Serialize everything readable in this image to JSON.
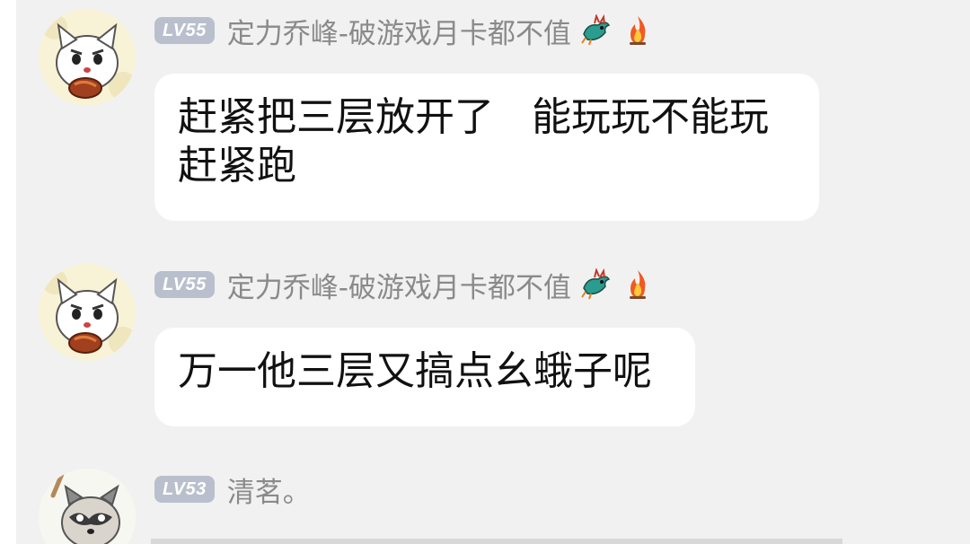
{
  "messages": [
    {
      "level": "LV55",
      "nickname": "定力乔峰-破游戏月卡都不值",
      "avatar": "white-cat-eating-meat",
      "badges": [
        "dragon-icon",
        "fire-icon"
      ],
      "text": "赶紧把三层放开了   能玩玩不能玩\n赶紧跑"
    },
    {
      "level": "LV55",
      "nickname": "定力乔峰-破游戏月卡都不值",
      "avatar": "white-cat-eating-meat",
      "badges": [
        "dragon-icon",
        "fire-icon"
      ],
      "text": "万一他三层又搞点幺蛾子呢"
    },
    {
      "level": "LV53",
      "nickname": "清茗。",
      "avatar": "raccoon-with-bat",
      "badges": [],
      "text": ""
    }
  ],
  "colors": {
    "background": "#f1f1f1",
    "bubble": "#ffffff",
    "level_badge": "#b9bfcc",
    "nickname": "#8a8a8a"
  }
}
